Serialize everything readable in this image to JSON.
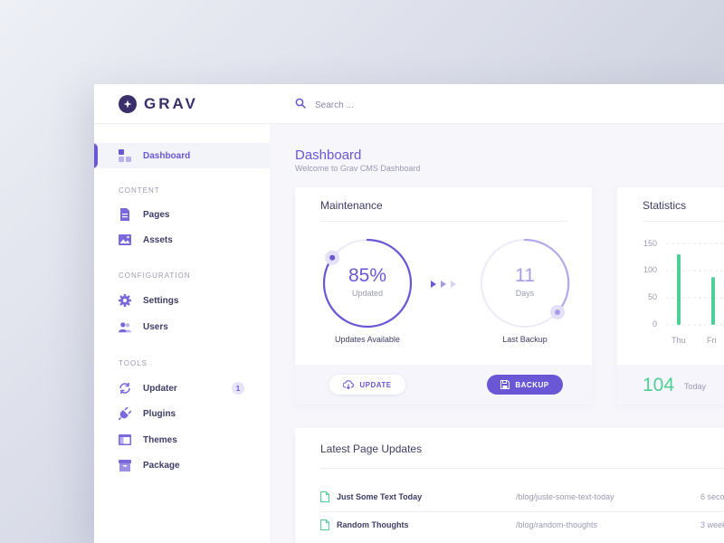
{
  "brand": {
    "name": "GRAV"
  },
  "search": {
    "placeholder": "Search ..."
  },
  "sidebar": {
    "active": {
      "label": "Dashboard"
    },
    "sections": [
      {
        "title": "CONTENT",
        "items": [
          {
            "label": "Pages",
            "icon": "page-icon"
          },
          {
            "label": "Assets",
            "icon": "image-icon"
          }
        ]
      },
      {
        "title": "CONFIGURATION",
        "items": [
          {
            "label": "Settings",
            "icon": "gear-icon"
          },
          {
            "label": "Users",
            "icon": "users-icon"
          }
        ]
      },
      {
        "title": "TOOLS",
        "items": [
          {
            "label": "Updater",
            "icon": "refresh-icon",
            "badge": "1"
          },
          {
            "label": "Plugins",
            "icon": "plug-icon"
          },
          {
            "label": "Themes",
            "icon": "window-icon"
          },
          {
            "label": "Package",
            "icon": "box-icon"
          }
        ]
      }
    ]
  },
  "header": {
    "title": "Dashboard",
    "subtitle": "Welcome to Grav CMS Dashboard"
  },
  "maintenance": {
    "title": "Maintenance",
    "updates": {
      "value": "85%",
      "unit": "Updated",
      "caption": "Updates Available",
      "fraction": 0.85
    },
    "backup": {
      "value": "11",
      "unit": "Days",
      "caption": "Last Backup"
    },
    "update_button": "UPDATE",
    "backup_button": "BACKUP"
  },
  "statistics": {
    "title": "Statistics",
    "today_count": "104",
    "today_label": "Today",
    "chart_data": {
      "type": "bar",
      "categories": [
        "Thu",
        "Fri"
      ],
      "values": [
        130,
        88
      ],
      "ylim": [
        0,
        150
      ],
      "yticks": [
        "150",
        "100",
        "50",
        "0"
      ],
      "grid": true
    }
  },
  "latest_updates": {
    "title": "Latest Page Updates",
    "rows": [
      {
        "name": "Just Some Text Today",
        "path": "/blog/juste-some-text-today",
        "time": "6 seco"
      },
      {
        "name": "Random Thoughts",
        "path": "/blog/random-thoughts",
        "time": "3 week"
      }
    ]
  },
  "colors": {
    "accent": "#6a57d6",
    "success": "#4fcf95",
    "dark": "#3b2f6b"
  }
}
